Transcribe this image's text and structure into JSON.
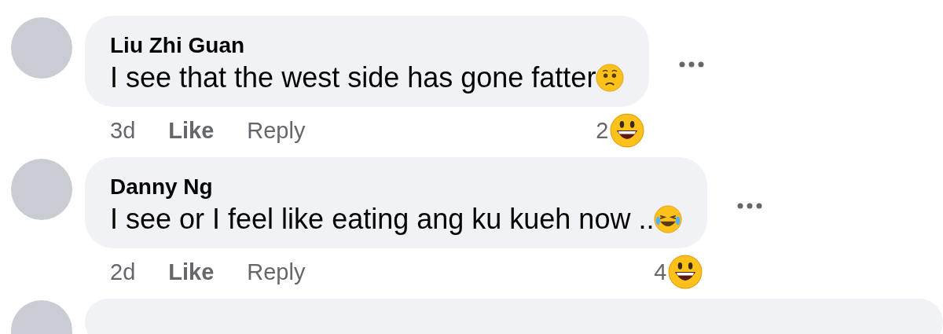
{
  "comments": [
    {
      "author": "Liu Zhi Guan",
      "text": "I see that the west side has gone fatter",
      "inline_emoji": {
        "kind": "worried"
      },
      "time": "3d",
      "like": "Like",
      "reply": "Reply",
      "reaction_count": "2",
      "reaction": {
        "kind": "grinning"
      }
    },
    {
      "author": "Danny Ng",
      "text": "I see or I feel like eating ang ku kueh now ..",
      "inline_emoji": {
        "kind": "laughing"
      },
      "time": "2d",
      "like": "Like",
      "reply": "Reply",
      "reaction_count": "4",
      "reaction": {
        "kind": "grinning"
      }
    }
  ]
}
